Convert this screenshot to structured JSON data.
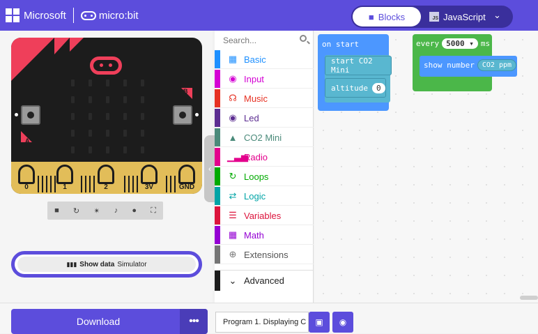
{
  "header": {
    "brand": "Microsoft",
    "product": "micro:bit",
    "mode_blocks": "Blocks",
    "mode_js": "JavaScript",
    "js_badge": "JS",
    "colors": {
      "bar": "#5c4ddc",
      "switch": "#3a2f9c"
    }
  },
  "simulator": {
    "pins": [
      "0",
      "1",
      "2",
      "3V",
      "GND"
    ],
    "button_a": "A",
    "button_b": "B",
    "show_data_icon": "bar-chart-icon",
    "show_data_label": "Show data",
    "show_data_sub": "Simulator",
    "toolbar_icons": [
      "stop-icon",
      "restart-icon",
      "debug-icon",
      "mute-icon",
      "screenshot-icon",
      "fullscreen-icon"
    ]
  },
  "toolbox": {
    "search_placeholder": "Search...",
    "categories": [
      {
        "label": "Basic",
        "color": "#1e90ff",
        "icon": "grid-icon"
      },
      {
        "label": "Input",
        "color": "#d400d4",
        "icon": "target-icon"
      },
      {
        "label": "Music",
        "color": "#e63022",
        "icon": "headphones-icon"
      },
      {
        "label": "Led",
        "color": "#5c2d91",
        "icon": "toggle-icon"
      },
      {
        "label": "CO2 Mini",
        "color": "#4a8a7a",
        "icon": "tree-icon"
      },
      {
        "label": "Radio",
        "color": "#e3008c",
        "icon": "signal-icon"
      },
      {
        "label": "Loops",
        "color": "#00aa00",
        "icon": "loop-icon"
      },
      {
        "label": "Logic",
        "color": "#00a4a6",
        "icon": "shuffle-icon"
      },
      {
        "label": "Variables",
        "color": "#dc143c",
        "icon": "lines-icon"
      },
      {
        "label": "Math",
        "color": "#9400d3",
        "icon": "calculator-icon"
      },
      {
        "label": "Extensions",
        "color": "#757575",
        "icon": "plus-icon"
      }
    ],
    "advanced": "Advanced"
  },
  "workspace": {
    "on_start": "on start",
    "start_co2": "start CO2 Mini",
    "altitude": "altitude",
    "altitude_value": "0",
    "every": "every",
    "every_value": "5000",
    "ms": "ms",
    "show_number": "show number",
    "co2_ppm": "CO2 ppm"
  },
  "footer": {
    "download": "Download",
    "more": "•••",
    "project_name": "Program 1. Displaying C"
  }
}
